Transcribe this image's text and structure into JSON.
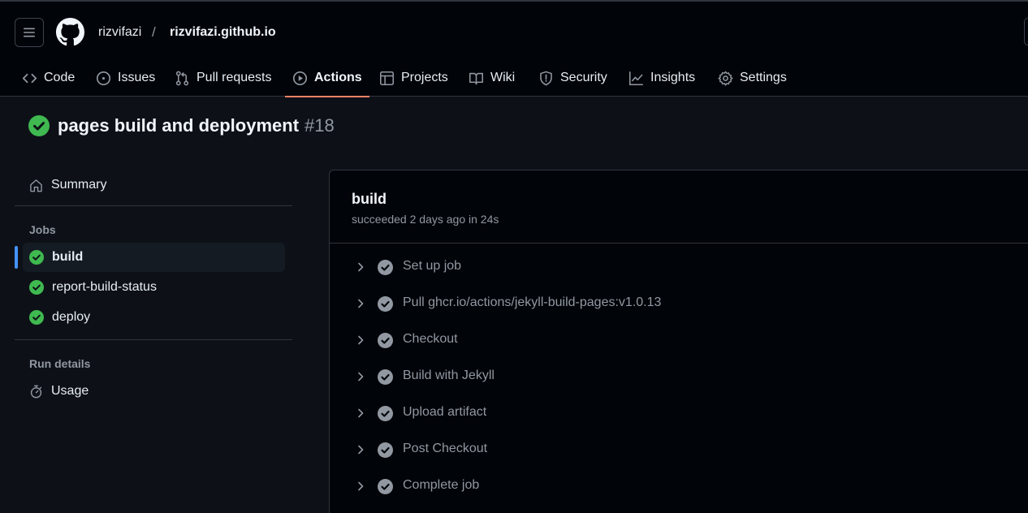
{
  "header": {
    "owner": "rizvifazi",
    "separator": "/",
    "repo": "rizvifazi.github.io"
  },
  "tabs": [
    {
      "label": "Code",
      "icon": "code-icon"
    },
    {
      "label": "Issues",
      "icon": "issue-icon"
    },
    {
      "label": "Pull requests",
      "icon": "pull-request-icon"
    },
    {
      "label": "Actions",
      "icon": "play-icon",
      "active": true
    },
    {
      "label": "Projects",
      "icon": "table-icon"
    },
    {
      "label": "Wiki",
      "icon": "book-icon"
    },
    {
      "label": "Security",
      "icon": "shield-icon"
    },
    {
      "label": "Insights",
      "icon": "graph-icon"
    },
    {
      "label": "Settings",
      "icon": "gear-icon"
    }
  ],
  "run": {
    "name": "pages build and deployment",
    "number": "#18",
    "status": "success"
  },
  "sidebar": {
    "summary_label": "Summary",
    "jobs_heading": "Jobs",
    "jobs": [
      {
        "label": "build",
        "status": "success",
        "selected": true
      },
      {
        "label": "report-build-status",
        "status": "success"
      },
      {
        "label": "deploy",
        "status": "success"
      }
    ],
    "run_details_heading": "Run details",
    "usage_label": "Usage"
  },
  "job": {
    "title": "build",
    "subtitle": "succeeded 2 days ago in 24s",
    "steps": [
      {
        "label": "Set up job"
      },
      {
        "label": "Pull ghcr.io/actions/jekyll-build-pages:v1.0.13"
      },
      {
        "label": "Checkout"
      },
      {
        "label": "Build with Jekyll"
      },
      {
        "label": "Upload artifact"
      },
      {
        "label": "Post Checkout"
      },
      {
        "label": "Complete job"
      }
    ]
  },
  "colors": {
    "background": "#0d1117",
    "header_bg": "#010409",
    "success_green": "#3fb950",
    "active_tab_underline": "#f78166",
    "selected_indicator": "#4493f8",
    "muted_text": "#9198a1",
    "border": "#30363d"
  }
}
